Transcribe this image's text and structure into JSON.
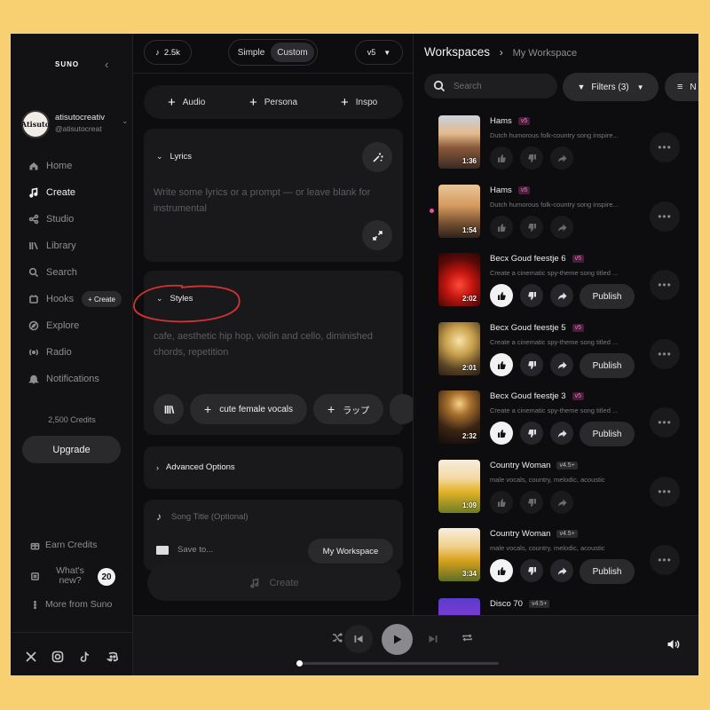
{
  "sidebar": {
    "logo": "SUNO",
    "profile": {
      "avatar_text": "Atisuto",
      "name": "atisutocreativ",
      "handle": "@atisutocreat"
    },
    "nav": [
      {
        "label": "Home",
        "icon": "home-icon"
      },
      {
        "label": "Create",
        "icon": "music-note-icon",
        "active": true
      },
      {
        "label": "Studio",
        "icon": "studio-icon"
      },
      {
        "label": "Library",
        "icon": "library-icon"
      },
      {
        "label": "Search",
        "icon": "search-icon"
      },
      {
        "label": "Hooks",
        "icon": "hooks-icon"
      },
      {
        "label": "Explore",
        "icon": "compass-icon"
      },
      {
        "label": "Radio",
        "icon": "radio-icon"
      },
      {
        "label": "Notifications",
        "icon": "bell-icon"
      }
    ],
    "hooks_create_label": "+ Create",
    "credits": "2,500 Credits",
    "upgrade_label": "Upgrade",
    "earn_credits": "Earn Credits",
    "whats_new": "What's new?",
    "whats_new_count": "20",
    "more_from_suno": "More from Suno",
    "socials": [
      "x-icon",
      "instagram-icon",
      "tiktok-icon",
      "discord-icon"
    ]
  },
  "create": {
    "credits_pill": "2.5k",
    "mode_simple": "Simple",
    "mode_custom": "Custom",
    "model": "v5",
    "add_audio": "Audio",
    "add_persona": "Persona",
    "add_inspo": "Inspo",
    "lyrics_title": "Lyrics",
    "lyrics_placeholder": "Write some lyrics or a prompt — or leave blank for instrumental",
    "styles_title": "Styles",
    "styles_placeholder": "cafe, aesthetic hip hop, violin and cello, diminished chords, repetition",
    "style_tags": [
      "cute female vocals",
      "ラップ"
    ],
    "advanced_options": "Advanced Options",
    "song_title_placeholder": "Song Title (Optional)",
    "save_to_label": "Save to...",
    "save_to_value": "My Workspace",
    "create_label": "Create"
  },
  "workspace": {
    "title": "Workspaces",
    "current": "My Workspace",
    "search_placeholder": "Search",
    "filters_label": "Filters (3)",
    "sort_label": "N",
    "songs": [
      {
        "title": "Hams",
        "version": "v5",
        "desc": "Dutch humorous folk-country song inspire...",
        "duration": "1:36",
        "publish": false
      },
      {
        "title": "Hams",
        "version": "v5",
        "desc": "Dutch humorous folk-country song inspire...",
        "duration": "1:54",
        "publish": false
      },
      {
        "title": "Becx Goud feestje 6",
        "version": "v5",
        "desc": "Create a cinematic spy-theme song titled ...",
        "duration": "2:02",
        "publish": true,
        "publish_label": "Publish"
      },
      {
        "title": "Becx Goud feestje 5",
        "version": "v5",
        "desc": "Create a cinematic spy-theme song titled ...",
        "duration": "2:01",
        "publish": true,
        "publish_label": "Publish"
      },
      {
        "title": "Becx Goud feestje 3",
        "version": "v5",
        "desc": "Create a cinematic spy-theme song titled ...",
        "duration": "2:32",
        "publish": true,
        "publish_label": "Publish"
      },
      {
        "title": "Country Woman",
        "version": "v4.5+",
        "desc": "male vocals, country, melodic, acoustic",
        "duration": "1:09",
        "publish": false
      },
      {
        "title": "Country Woman",
        "version": "v4.5+",
        "desc": "male vocals, country, melodic, acoustic",
        "duration": "3:34",
        "publish": true,
        "publish_label": "Publish"
      },
      {
        "title": "Disco 70",
        "version": "v4.5+",
        "desc": "",
        "duration": "",
        "publish": false
      }
    ]
  },
  "player": {
    "progress": 0.01
  }
}
